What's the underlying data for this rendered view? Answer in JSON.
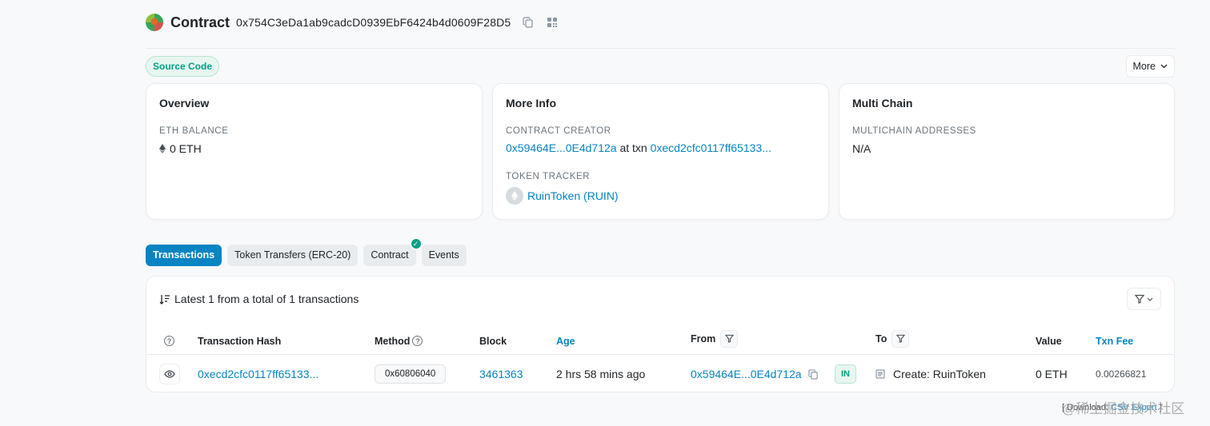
{
  "header": {
    "title": "Contract",
    "address": "0x754C3eDa1ab9cadcD0939EbF6424b4d0609F28D5"
  },
  "toolbar": {
    "source_code_label": "Source Code",
    "more_label": "More"
  },
  "overview": {
    "title": "Overview",
    "balance_label": "ETH BALANCE",
    "balance_value": "0 ETH"
  },
  "more_info": {
    "title": "More Info",
    "creator_label": "CONTRACT CREATOR",
    "creator_address": "0x59464E...0E4d712a",
    "at_txn_text": "at txn",
    "creator_txn": "0xecd2cfc0117ff65133...",
    "token_tracker_label": "TOKEN TRACKER",
    "token_name": "RuinToken (RUIN)"
  },
  "multi_chain": {
    "title": "Multi Chain",
    "addresses_label": "MULTICHAIN ADDRESSES",
    "addresses_value": "N/A"
  },
  "tabs": [
    {
      "label": "Transactions",
      "active": true
    },
    {
      "label": "Token Transfers (ERC-20)",
      "active": false
    },
    {
      "label": "Contract",
      "active": false
    },
    {
      "label": "Events",
      "active": false
    }
  ],
  "transactions": {
    "summary": "Latest 1 from a total of 1 transactions",
    "columns": {
      "hash": "Transaction Hash",
      "method": "Method",
      "block": "Block",
      "age": "Age",
      "from": "From",
      "to": "To",
      "value": "Value",
      "fee": "Txn Fee"
    },
    "rows": [
      {
        "hash": "0xecd2cfc0117ff65133...",
        "method": "0x60806040",
        "block": "3461363",
        "age": "2 hrs 58 mins ago",
        "from": "0x59464E...0E4d712a",
        "direction": "IN",
        "to": "Create: RuinToken",
        "value": "0 ETH",
        "fee": "0.00266821"
      }
    ]
  },
  "footer": {
    "prefix": "[ Download:",
    "csv_label": "CSV Export",
    "suffix": "]"
  },
  "watermark": "@稀土掘金技术社区",
  "colors": {
    "accent": "#0784c3",
    "success": "#00a186"
  }
}
